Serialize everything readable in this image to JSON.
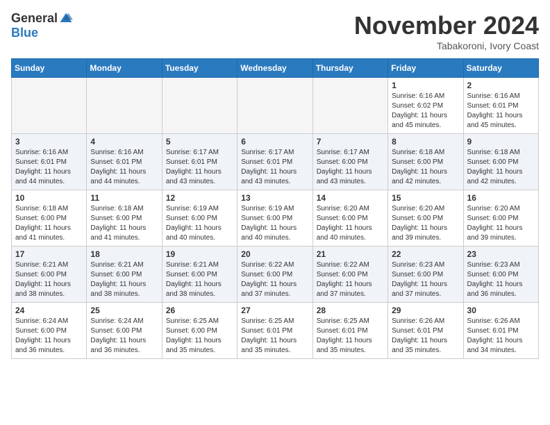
{
  "header": {
    "logo_general": "General",
    "logo_blue": "Blue",
    "month_title": "November 2024",
    "subtitle": "Tabakoroni, Ivory Coast"
  },
  "weekdays": [
    "Sunday",
    "Monday",
    "Tuesday",
    "Wednesday",
    "Thursday",
    "Friday",
    "Saturday"
  ],
  "weeks": [
    [
      {
        "day": "",
        "empty": true
      },
      {
        "day": "",
        "empty": true
      },
      {
        "day": "",
        "empty": true
      },
      {
        "day": "",
        "empty": true
      },
      {
        "day": "",
        "empty": true
      },
      {
        "day": "1",
        "sunrise": "Sunrise: 6:16 AM",
        "sunset": "Sunset: 6:02 PM",
        "daylight": "Daylight: 11 hours and 45 minutes."
      },
      {
        "day": "2",
        "sunrise": "Sunrise: 6:16 AM",
        "sunset": "Sunset: 6:01 PM",
        "daylight": "Daylight: 11 hours and 45 minutes."
      }
    ],
    [
      {
        "day": "3",
        "sunrise": "Sunrise: 6:16 AM",
        "sunset": "Sunset: 6:01 PM",
        "daylight": "Daylight: 11 hours and 44 minutes."
      },
      {
        "day": "4",
        "sunrise": "Sunrise: 6:16 AM",
        "sunset": "Sunset: 6:01 PM",
        "daylight": "Daylight: 11 hours and 44 minutes."
      },
      {
        "day": "5",
        "sunrise": "Sunrise: 6:17 AM",
        "sunset": "Sunset: 6:01 PM",
        "daylight": "Daylight: 11 hours and 43 minutes."
      },
      {
        "day": "6",
        "sunrise": "Sunrise: 6:17 AM",
        "sunset": "Sunset: 6:01 PM",
        "daylight": "Daylight: 11 hours and 43 minutes."
      },
      {
        "day": "7",
        "sunrise": "Sunrise: 6:17 AM",
        "sunset": "Sunset: 6:00 PM",
        "daylight": "Daylight: 11 hours and 43 minutes."
      },
      {
        "day": "8",
        "sunrise": "Sunrise: 6:18 AM",
        "sunset": "Sunset: 6:00 PM",
        "daylight": "Daylight: 11 hours and 42 minutes."
      },
      {
        "day": "9",
        "sunrise": "Sunrise: 6:18 AM",
        "sunset": "Sunset: 6:00 PM",
        "daylight": "Daylight: 11 hours and 42 minutes."
      }
    ],
    [
      {
        "day": "10",
        "sunrise": "Sunrise: 6:18 AM",
        "sunset": "Sunset: 6:00 PM",
        "daylight": "Daylight: 11 hours and 41 minutes."
      },
      {
        "day": "11",
        "sunrise": "Sunrise: 6:18 AM",
        "sunset": "Sunset: 6:00 PM",
        "daylight": "Daylight: 11 hours and 41 minutes."
      },
      {
        "day": "12",
        "sunrise": "Sunrise: 6:19 AM",
        "sunset": "Sunset: 6:00 PM",
        "daylight": "Daylight: 11 hours and 40 minutes."
      },
      {
        "day": "13",
        "sunrise": "Sunrise: 6:19 AM",
        "sunset": "Sunset: 6:00 PM",
        "daylight": "Daylight: 11 hours and 40 minutes."
      },
      {
        "day": "14",
        "sunrise": "Sunrise: 6:20 AM",
        "sunset": "Sunset: 6:00 PM",
        "daylight": "Daylight: 11 hours and 40 minutes."
      },
      {
        "day": "15",
        "sunrise": "Sunrise: 6:20 AM",
        "sunset": "Sunset: 6:00 PM",
        "daylight": "Daylight: 11 hours and 39 minutes."
      },
      {
        "day": "16",
        "sunrise": "Sunrise: 6:20 AM",
        "sunset": "Sunset: 6:00 PM",
        "daylight": "Daylight: 11 hours and 39 minutes."
      }
    ],
    [
      {
        "day": "17",
        "sunrise": "Sunrise: 6:21 AM",
        "sunset": "Sunset: 6:00 PM",
        "daylight": "Daylight: 11 hours and 38 minutes."
      },
      {
        "day": "18",
        "sunrise": "Sunrise: 6:21 AM",
        "sunset": "Sunset: 6:00 PM",
        "daylight": "Daylight: 11 hours and 38 minutes."
      },
      {
        "day": "19",
        "sunrise": "Sunrise: 6:21 AM",
        "sunset": "Sunset: 6:00 PM",
        "daylight": "Daylight: 11 hours and 38 minutes."
      },
      {
        "day": "20",
        "sunrise": "Sunrise: 6:22 AM",
        "sunset": "Sunset: 6:00 PM",
        "daylight": "Daylight: 11 hours and 37 minutes."
      },
      {
        "day": "21",
        "sunrise": "Sunrise: 6:22 AM",
        "sunset": "Sunset: 6:00 PM",
        "daylight": "Daylight: 11 hours and 37 minutes."
      },
      {
        "day": "22",
        "sunrise": "Sunrise: 6:23 AM",
        "sunset": "Sunset: 6:00 PM",
        "daylight": "Daylight: 11 hours and 37 minutes."
      },
      {
        "day": "23",
        "sunrise": "Sunrise: 6:23 AM",
        "sunset": "Sunset: 6:00 PM",
        "daylight": "Daylight: 11 hours and 36 minutes."
      }
    ],
    [
      {
        "day": "24",
        "sunrise": "Sunrise: 6:24 AM",
        "sunset": "Sunset: 6:00 PM",
        "daylight": "Daylight: 11 hours and 36 minutes."
      },
      {
        "day": "25",
        "sunrise": "Sunrise: 6:24 AM",
        "sunset": "Sunset: 6:00 PM",
        "daylight": "Daylight: 11 hours and 36 minutes."
      },
      {
        "day": "26",
        "sunrise": "Sunrise: 6:25 AM",
        "sunset": "Sunset: 6:00 PM",
        "daylight": "Daylight: 11 hours and 35 minutes."
      },
      {
        "day": "27",
        "sunrise": "Sunrise: 6:25 AM",
        "sunset": "Sunset: 6:01 PM",
        "daylight": "Daylight: 11 hours and 35 minutes."
      },
      {
        "day": "28",
        "sunrise": "Sunrise: 6:25 AM",
        "sunset": "Sunset: 6:01 PM",
        "daylight": "Daylight: 11 hours and 35 minutes."
      },
      {
        "day": "29",
        "sunrise": "Sunrise: 6:26 AM",
        "sunset": "Sunset: 6:01 PM",
        "daylight": "Daylight: 11 hours and 35 minutes."
      },
      {
        "day": "30",
        "sunrise": "Sunrise: 6:26 AM",
        "sunset": "Sunset: 6:01 PM",
        "daylight": "Daylight: 11 hours and 34 minutes."
      }
    ]
  ]
}
